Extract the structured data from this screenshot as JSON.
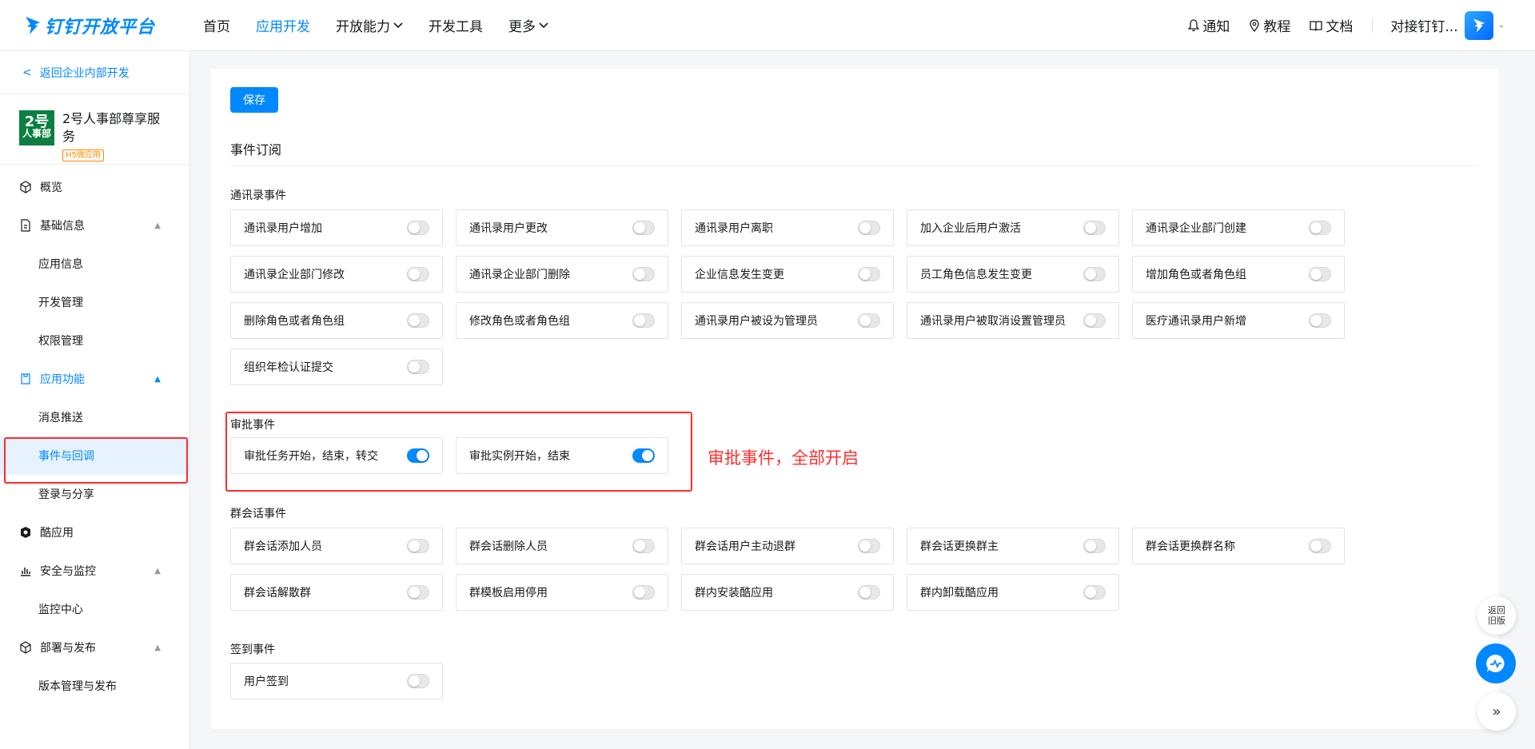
{
  "header": {
    "logo_text": "钉钉开放平台",
    "nav": [
      {
        "label": "首页",
        "active": false,
        "dropdown": false
      },
      {
        "label": "应用开发",
        "active": true,
        "dropdown": false
      },
      {
        "label": "开放能力",
        "active": false,
        "dropdown": true
      },
      {
        "label": "开发工具",
        "active": false,
        "dropdown": false
      },
      {
        "label": "更多",
        "active": false,
        "dropdown": true
      }
    ],
    "right": {
      "notify": "通知",
      "tutorial": "教程",
      "docs": "文档",
      "org_name": "对接钉钉..."
    }
  },
  "sidebar": {
    "back_label": "返回企业内部开发",
    "app": {
      "icon_top": "2号",
      "icon_bottom": "人事部",
      "name": "2号人事部尊享服务",
      "tag": "H5微应用"
    },
    "menu": {
      "overview": "概览",
      "basic_info": "基础信息",
      "app_info": "应用信息",
      "dev_manage": "开发管理",
      "perm_manage": "权限管理",
      "app_features": "应用功能",
      "message_push": "消息推送",
      "events_callback": "事件与回调",
      "login_share": "登录与分享",
      "cool_app": "酷应用",
      "security_monitor": "安全与监控",
      "monitor_center": "监控中心",
      "deploy_publish": "部署与发布",
      "version_publish": "版本管理与发布"
    }
  },
  "main": {
    "save_label": "保存",
    "section_title": "事件订阅",
    "groups": {
      "contacts": {
        "label": "通讯录事件",
        "items": [
          {
            "label": "通讯录用户增加",
            "on": false
          },
          {
            "label": "通讯录用户更改",
            "on": false
          },
          {
            "label": "通讯录用户离职",
            "on": false
          },
          {
            "label": "加入企业后用户激活",
            "on": false
          },
          {
            "label": "通讯录企业部门创建",
            "on": false
          },
          {
            "label": "通讯录企业部门修改",
            "on": false
          },
          {
            "label": "通讯录企业部门删除",
            "on": false
          },
          {
            "label": "企业信息发生变更",
            "on": false
          },
          {
            "label": "员工角色信息发生变更",
            "on": false
          },
          {
            "label": "增加角色或者角色组",
            "on": false
          },
          {
            "label": "删除角色或者角色组",
            "on": false
          },
          {
            "label": "修改角色或者角色组",
            "on": false
          },
          {
            "label": "通讯录用户被设为管理员",
            "on": false
          },
          {
            "label": "通讯录用户被取消设置管理员",
            "on": false
          },
          {
            "label": "医疗通讯录用户新增",
            "on": false
          },
          {
            "label": "组织年检认证提交",
            "on": false
          }
        ]
      },
      "approval": {
        "label": "审批事件",
        "items": [
          {
            "label": "审批任务开始，结束，转交",
            "on": true
          },
          {
            "label": "审批实例开始，结束",
            "on": true
          }
        ]
      },
      "group_chat": {
        "label": "群会话事件",
        "items": [
          {
            "label": "群会话添加人员",
            "on": false
          },
          {
            "label": "群会话删除人员",
            "on": false
          },
          {
            "label": "群会话用户主动退群",
            "on": false
          },
          {
            "label": "群会话更换群主",
            "on": false
          },
          {
            "label": "群会话更换群名称",
            "on": false
          },
          {
            "label": "群会话解散群",
            "on": false
          },
          {
            "label": "群模板启用停用",
            "on": false
          },
          {
            "label": "群内安装酷应用",
            "on": false
          },
          {
            "label": "群内卸载酷应用",
            "on": false
          }
        ]
      },
      "checkin": {
        "label": "签到事件",
        "items": [
          {
            "label": "用户签到",
            "on": false
          }
        ]
      }
    },
    "annotation": "审批事件，全部开启"
  },
  "floating": {
    "old_version": "返回旧版"
  },
  "colors": {
    "brand": "#0089ff",
    "annotation": "#ff2d2d"
  }
}
